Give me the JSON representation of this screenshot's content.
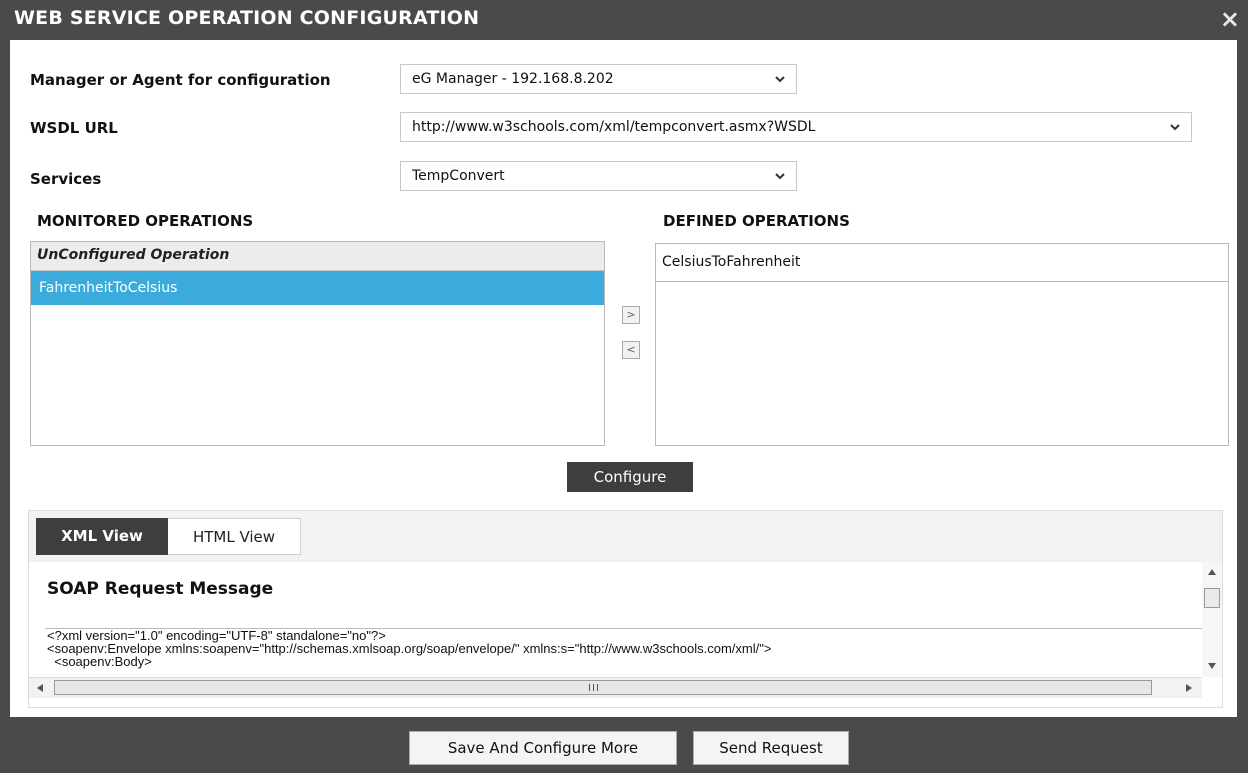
{
  "dialog": {
    "title": "WEB SERVICE OPERATION CONFIGURATION",
    "close_glyph": "×"
  },
  "form": {
    "manager_label": "Manager or Agent for configuration",
    "manager_value": "eG Manager - 192.168.8.202",
    "wsdl_label": "WSDL URL",
    "wsdl_value": "http://www.w3schools.com/xml/tempconvert.asmx?WSDL",
    "services_label": "Services",
    "services_value": "TempConvert"
  },
  "monitored": {
    "heading": "MONITORED OPERATIONS",
    "group_header": "UnConfigured Operation",
    "items": [
      "FahrenheitToCelsius"
    ]
  },
  "defined": {
    "heading": "DEFINED OPERATIONS",
    "items": [
      "CelsiusToFahrenheit"
    ]
  },
  "move": {
    "right_glyph": ">",
    "left_glyph": "<"
  },
  "configure_label": "Configure",
  "tabs": {
    "xml": "XML View",
    "html": "HTML View"
  },
  "soap": {
    "title": "SOAP Request Message",
    "lines": [
      "<?xml version=\"1.0\" encoding=\"UTF-8\" standalone=\"no\"?>",
      "<soapenv:Envelope xmlns:soapenv=\"http://schemas.xmlsoap.org/soap/envelope/\" xmlns:s=\"http://www.w3schools.com/xml/\">",
      "  <soapenv:Body>"
    ]
  },
  "footer": {
    "save_more": "Save And Configure More",
    "send": "Send Request"
  },
  "colors": {
    "frame": "#4a4a4a",
    "selected": "#3aabda",
    "dark_button": "#3e3e3e"
  }
}
